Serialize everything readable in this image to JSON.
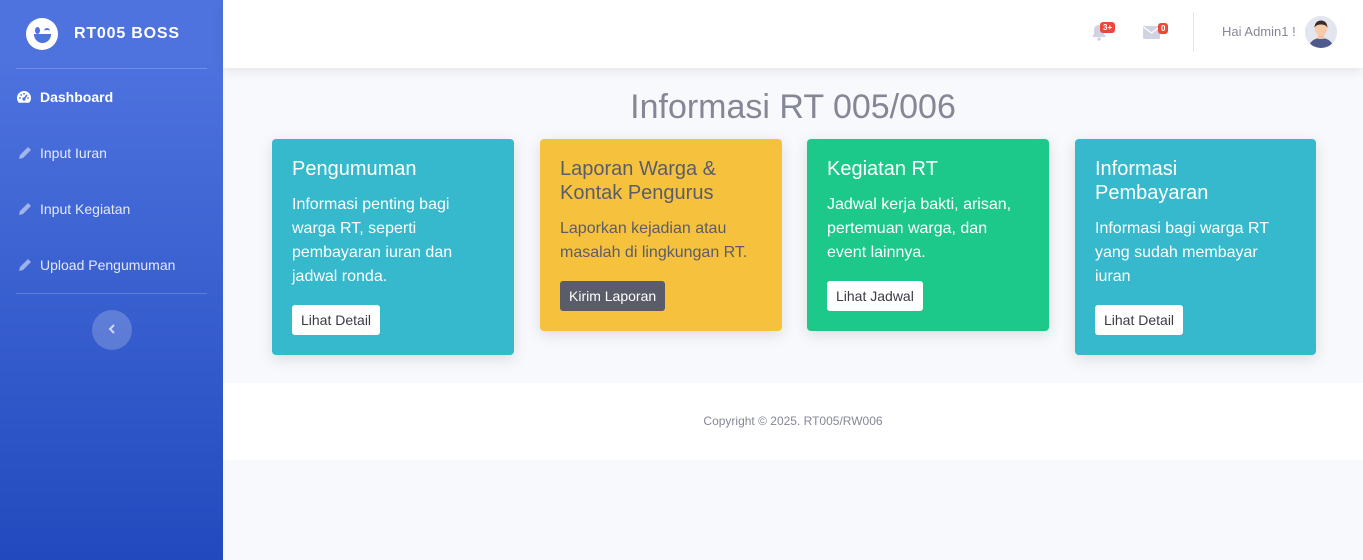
{
  "sidebar": {
    "brand": "RT005 BOSS",
    "items": [
      {
        "label": "Dashboard",
        "icon": "tachometer-icon",
        "active": true
      },
      {
        "label": "Input Iuran",
        "icon": "pencil-icon"
      },
      {
        "label": "Input Kegiatan",
        "icon": "pencil-icon"
      },
      {
        "label": "Upload Pengumuman",
        "icon": "pencil-icon"
      }
    ]
  },
  "topbar": {
    "alerts_badge": "3+",
    "messages_badge": "0",
    "user_greeting": "Hai Admin1 !"
  },
  "main": {
    "title": "Informasi RT 005/006",
    "cards": [
      {
        "title": "Pengumuman",
        "text": "Informasi penting bagi warga RT, seperti pembayaran iuran dan jadwal ronda.",
        "button": "Lihat Detail",
        "color": "#36b9cc"
      },
      {
        "title": "Laporan Warga & Kontak Pengurus",
        "text": "Laporkan kejadian atau masalah di lingkungan RT.",
        "button": "Kirim Laporan",
        "color": "#f6c23e"
      },
      {
        "title": "Kegiatan RT",
        "text": "Jadwal kerja bakti, arisan, pertemuan warga, dan event lainnya.",
        "button": "Lihat Jadwal",
        "color": "#1cc88a"
      },
      {
        "title": "Informasi Pembayaran",
        "text": "Informasi bagi warga RT yang sudah membayar iuran",
        "button": "Lihat Detail",
        "color": "#36b9cc"
      }
    ]
  },
  "footer": {
    "copyright": "Copyright © 2025. RT005/RW006"
  }
}
